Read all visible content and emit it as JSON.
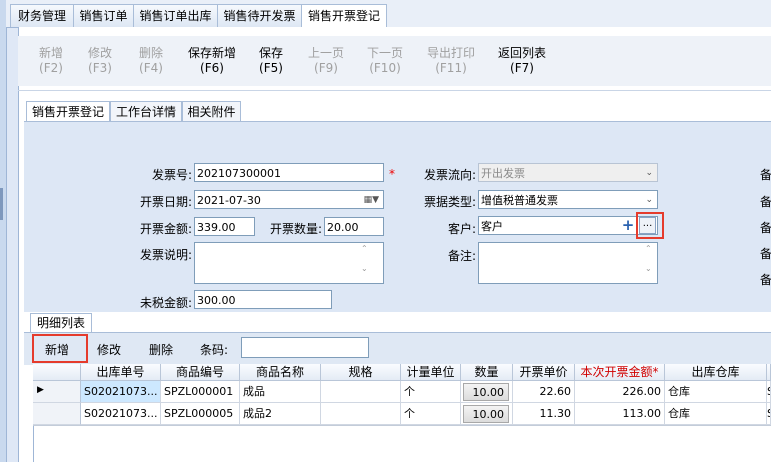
{
  "top_tabs": [
    "财务管理",
    "销售订单",
    "销售订单出库",
    "销售待开发票",
    "销售开票登记"
  ],
  "toolbar": {
    "buttons": [
      {
        "label": "新增",
        "key": "(F2)",
        "enabled": false
      },
      {
        "label": "修改",
        "key": "(F3)",
        "enabled": false
      },
      {
        "label": "删除",
        "key": "(F4)",
        "enabled": false
      },
      {
        "label": "保存新增",
        "key": "(F6)",
        "enabled": true
      },
      {
        "label": "保存",
        "key": "(F5)",
        "enabled": true
      },
      {
        "label": "上一页",
        "key": "(F9)",
        "enabled": false
      },
      {
        "label": "下一页",
        "key": "(F10)",
        "enabled": false
      },
      {
        "label": "导出打印",
        "key": "(F11)",
        "enabled": false
      },
      {
        "label": "返回列表",
        "key": "(F7)",
        "enabled": true
      }
    ]
  },
  "sub_tabs": [
    "销售开票登记",
    "工作台详情",
    "相关附件"
  ],
  "form": {
    "invoice_no_label": "发票号:",
    "invoice_no": "202107300001",
    "required_mark": "*",
    "date_label": "开票日期:",
    "date": "2021-07-30",
    "amount_label": "开票金额:",
    "amount": "339.00",
    "qty_label": "开票数量:",
    "qty": "20.00",
    "desc_label": "发票说明:",
    "desc": "",
    "untaxed_label": "未税金额:",
    "untaxed": "300.00",
    "direction_label": "发票流向:",
    "direction": "开出发票",
    "type_label": "票据类型:",
    "type": "增值税普通发票",
    "customer_label": "客户:",
    "customer": "客户",
    "remark_label": "备注:",
    "remark": "",
    "right_labels": [
      "备",
      "备",
      "备",
      "备",
      "备"
    ]
  },
  "detail": {
    "tab_label": "明细列表",
    "add_label": "新增",
    "edit_label": "修改",
    "delete_label": "删除",
    "barcode_label": "条码:",
    "barcode_value": "",
    "columns": [
      "出库单号",
      "商品编号",
      "商品名称",
      "规格",
      "计量单位",
      "数量",
      "开票单价",
      "本次开票金额*",
      "出库仓库"
    ],
    "rows": [
      {
        "order_no": "S02021073...",
        "code": "SPZL000001",
        "name": "成品",
        "spec": "",
        "unit": "个",
        "qty": "10.00",
        "price": "22.60",
        "amount": "226.00",
        "warehouse": "仓库",
        "extra": "S"
      },
      {
        "order_no": "S02021073...",
        "code": "SPZL000005",
        "name": "成品2",
        "spec": "",
        "unit": "个",
        "qty": "10.00",
        "price": "11.30",
        "amount": "113.00",
        "warehouse": "仓库",
        "extra": "S"
      }
    ]
  },
  "colors": {
    "accent_red": "#e53b2c",
    "required_header": "#d00000"
  }
}
